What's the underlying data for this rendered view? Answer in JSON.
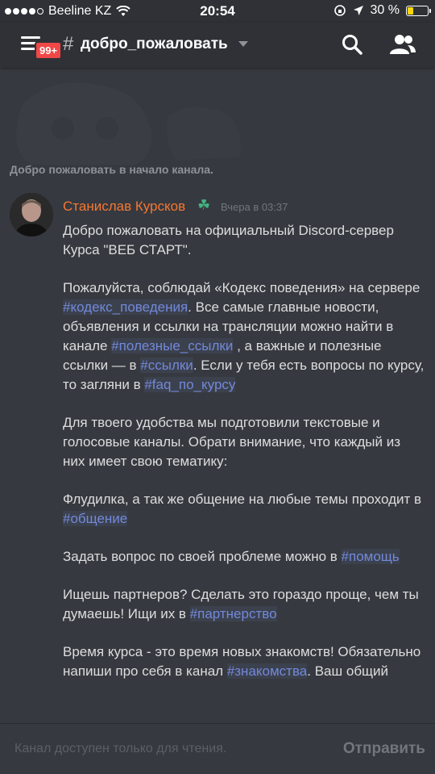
{
  "status_bar": {
    "carrier": "Beeline KZ",
    "time": "20:54",
    "battery": "30 %",
    "battery_level": 0.3
  },
  "header": {
    "badge": "99+",
    "hash": "#",
    "channel_name": "добро_пожаловать"
  },
  "content": {
    "welcome_text": "Добро пожаловать в начало канала.",
    "message": {
      "author": "Станислав Курсков",
      "author_emoji": "☘",
      "timestamp": "Вчера в 03:37",
      "p1": "Добро пожаловать на официальный Discord-сервер Курса \"ВЕБ СТАРТ\".",
      "p2_a": "Пожалуйста, соблюдай «Кодекс поведения» на сервере ",
      "p2_m1": "#кодекс_поведения",
      "p2_b": ". Все самые главные новости, объявления и ссылки на трансляции можно найти в канале ",
      "p2_m2": "#полезные_ссылки",
      "p2_c": " , а важные и полезные ссылки — в ",
      "p2_m3": "#ссылки",
      "p2_d": ". Если у тебя есть вопросы по курсу, то загляни в ",
      "p2_m4": "#faq_по_курсу",
      "p3": "Для твоего удобства мы подготовили текстовые и голосовые каналы. Обрати внимание, что каждый из них имеет свою тематику:",
      "p4_a": "Флудилка, а так же общение на любые темы проходит в ",
      "p4_m": "#общение",
      "p5_a": "Задать вопрос по своей проблеме можно в ",
      "p5_m": "#помощь",
      "p6_a": "Ищешь партнеров? Сделать это гораздо проще, чем ты думаешь! Ищи их в ",
      "p6_m": "#партнерство",
      "p7_a": "Время курса - это время новых знакомств! Обязательно напиши про себя в канал ",
      "p7_m": "#знакомства",
      "p7_b": ". Ваш общий"
    }
  },
  "composer": {
    "placeholder": "Канал доступен только для чтения.",
    "send_label": "Отправить"
  },
  "colors": {
    "background": "#36393f",
    "header": "#2f3136",
    "mention": "#7289da",
    "author": "#f57731",
    "badge": "#f04747"
  }
}
